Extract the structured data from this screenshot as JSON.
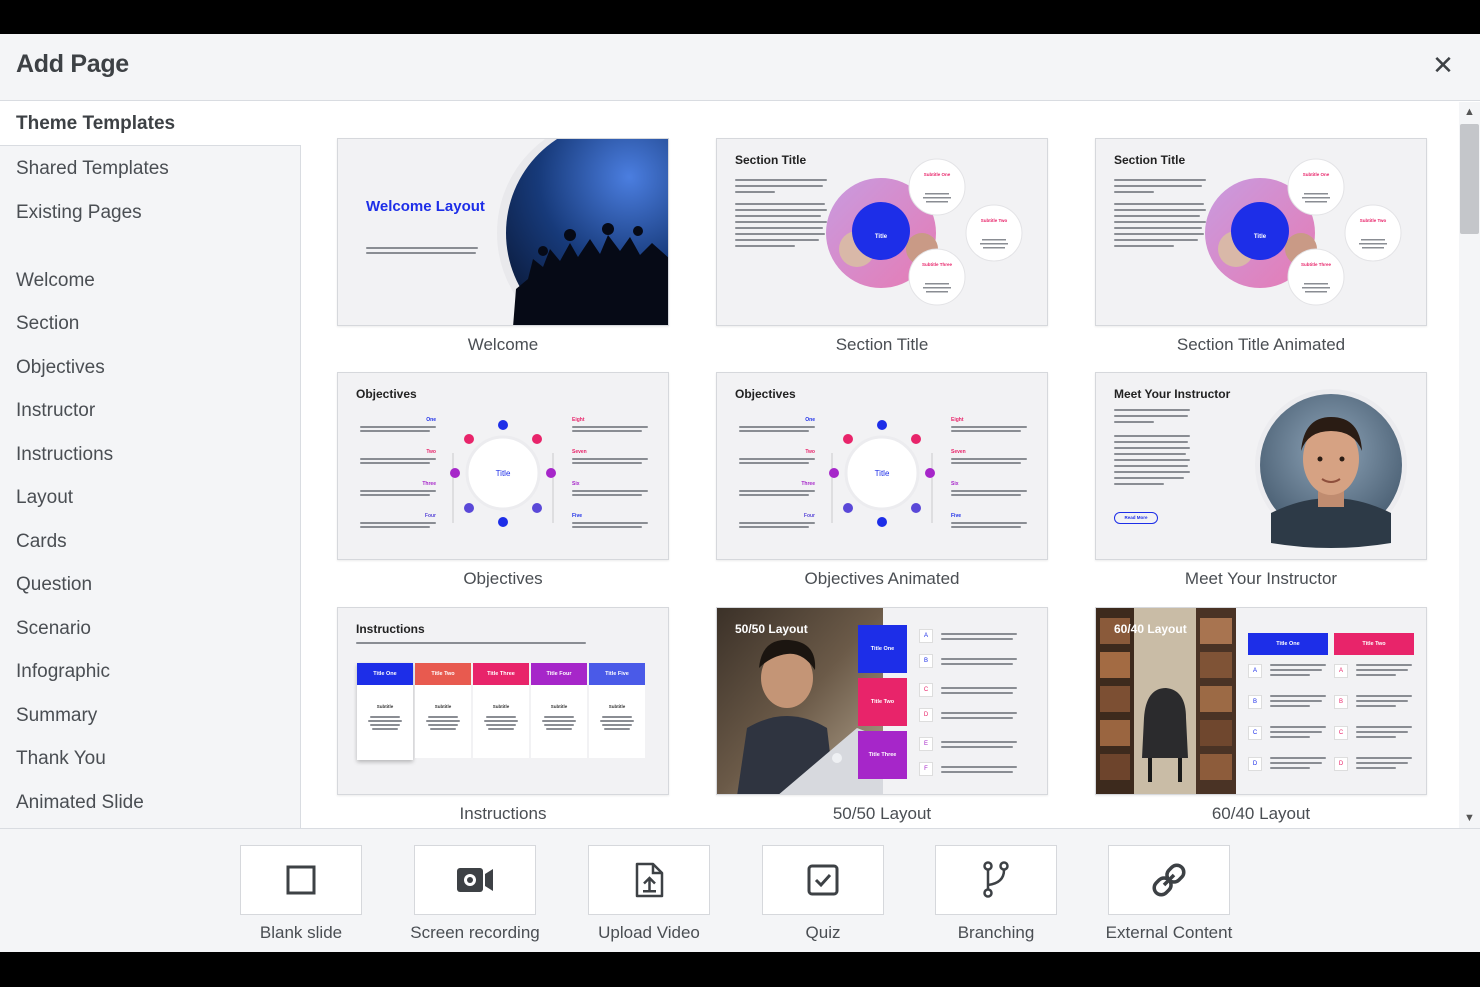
{
  "dialog": {
    "title": "Add Page"
  },
  "sidebar": {
    "active_tab": "Theme Templates",
    "tabs": [
      "Shared Templates",
      "Existing Pages"
    ],
    "categories": [
      "Welcome",
      "Section",
      "Objectives",
      "Instructor",
      "Instructions",
      "Layout",
      "Cards",
      "Question",
      "Scenario",
      "Infographic",
      "Summary",
      "Thank You",
      "Animated Slide"
    ]
  },
  "templates": [
    {
      "label": "Welcome",
      "title": "Welcome Layout"
    },
    {
      "label": "Section Title",
      "title": "Section Title",
      "center": "Title",
      "bubbles": [
        "Subtitle One",
        "Subtitle Two",
        "Subtitle Three"
      ]
    },
    {
      "label": "Section Title Animated",
      "title": "Section Title",
      "center": "Title",
      "bubbles": [
        "Subtitle One",
        "Subtitle Two",
        "Subtitle Three"
      ]
    },
    {
      "label": "Objectives",
      "title": "Objectives",
      "center": "Title",
      "left": [
        "One",
        "Two",
        "Three",
        "Four"
      ],
      "right": [
        "Eight",
        "Seven",
        "Six",
        "Five"
      ]
    },
    {
      "label": "Objectives Animated",
      "title": "Objectives",
      "center": "Title",
      "left": [
        "One",
        "Two",
        "Three",
        "Four"
      ],
      "right": [
        "Eight",
        "Seven",
        "Six",
        "Five"
      ]
    },
    {
      "label": "Meet Your Instructor",
      "title": "Meet Your Instructor",
      "button": "Read More"
    },
    {
      "label": "Instructions",
      "title": "Instructions",
      "cols": [
        "Title One",
        "Title Two",
        "Title Three",
        "Title Four",
        "Title Five"
      ],
      "sub": "Subtitle"
    },
    {
      "label": "50/50 Layout",
      "title": "50/50 Layout",
      "blocks": [
        "Title One",
        "Title Two",
        "Title Three"
      ],
      "letters": [
        "A",
        "B",
        "C",
        "D",
        "E",
        "F"
      ]
    },
    {
      "label": "60/40 Layout",
      "title": "60/40 Layout",
      "heads": [
        "Title One",
        "Title Two"
      ],
      "letters": [
        "A",
        "B",
        "C",
        "D"
      ]
    }
  ],
  "tools": [
    {
      "label": "Blank slide",
      "icon": "square-icon"
    },
    {
      "label": "Screen recording",
      "icon": "video-camera-icon"
    },
    {
      "label": "Upload Video",
      "icon": "file-upload-icon"
    },
    {
      "label": "Quiz",
      "icon": "checkbox-icon"
    },
    {
      "label": "Branching",
      "icon": "branch-icon"
    },
    {
      "label": "External Content",
      "icon": "link-icon"
    }
  ],
  "colors": {
    "blue": "#1d2ee8",
    "pink": "#e8246a",
    "purple": "#a626c9",
    "red": "#e8365c",
    "orange": "#e85a4f"
  }
}
